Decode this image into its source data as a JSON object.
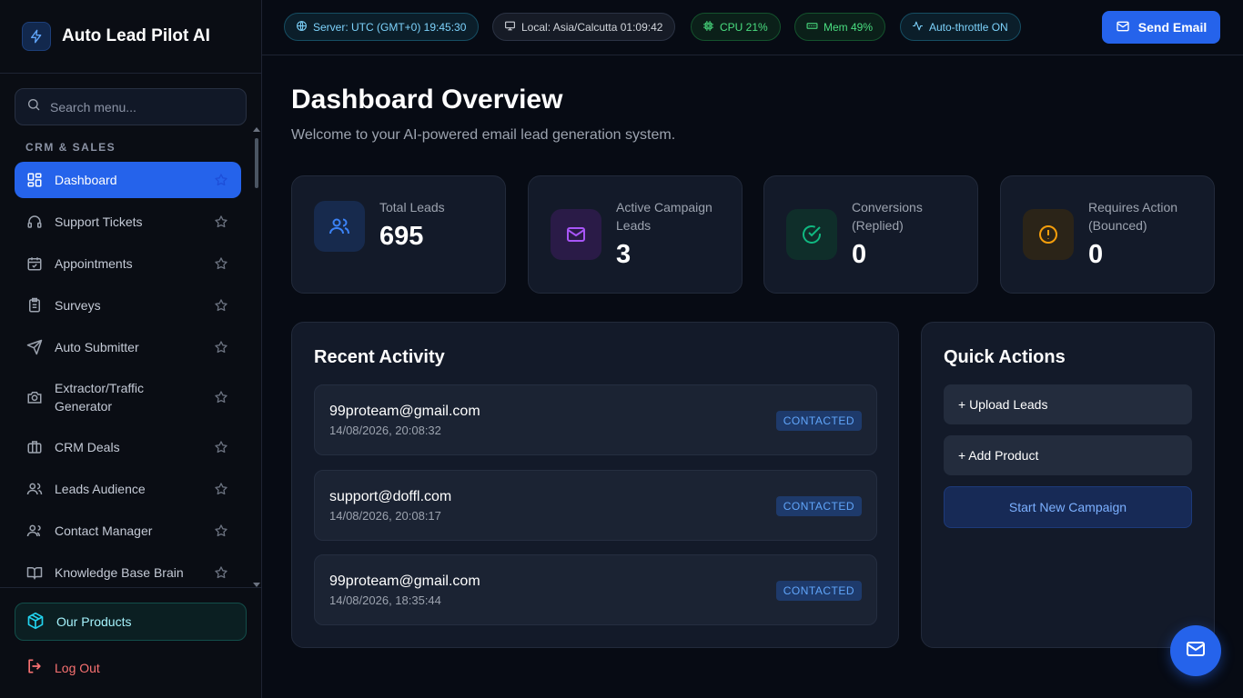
{
  "brand": {
    "title": "Auto Lead Pilot AI",
    "icon": "bolt-icon"
  },
  "search": {
    "placeholder": "Search menu..."
  },
  "sidebar": {
    "section_label": "CRM & SALES",
    "items": [
      {
        "label": "Dashboard",
        "icon": "dashboard-grid-icon",
        "active": true
      },
      {
        "label": "Support Tickets",
        "icon": "headset-icon"
      },
      {
        "label": "Appointments",
        "icon": "calendar-check-icon"
      },
      {
        "label": "Surveys",
        "icon": "clipboard-list-icon"
      },
      {
        "label": "Auto Submitter",
        "icon": "send-icon"
      },
      {
        "label": "Extractor/Traffic Generator",
        "icon": "camera-icon"
      },
      {
        "label": "CRM Deals",
        "icon": "briefcase-icon"
      },
      {
        "label": "Leads Audience",
        "icon": "users-icon"
      },
      {
        "label": "Contact Manager",
        "icon": "user-group-icon"
      },
      {
        "label": "Knowledge Base Brain",
        "icon": "book-open-icon"
      }
    ],
    "footer": {
      "products_label": "Our Products",
      "logout_label": "Log Out"
    }
  },
  "topbar": {
    "server": "Server: UTC (GMT+0) 19:45:30",
    "local": "Local: Asia/Calcutta 01:09:42",
    "cpu": "CPU 21%",
    "mem": "Mem 49%",
    "throttle": "Auto-throttle ON",
    "send_email_label": "Send Email"
  },
  "page": {
    "title": "Dashboard Overview",
    "subtitle": "Welcome to your AI-powered email lead generation system."
  },
  "stats": [
    {
      "label": "Total Leads",
      "value": "695",
      "icon": "users-icon",
      "color": "#3b82f6"
    },
    {
      "label": "Active Campaign Leads",
      "value": "3",
      "icon": "mail-icon",
      "color": "#a855f7"
    },
    {
      "label": "Conversions (Replied)",
      "value": "0",
      "icon": "check-circle-icon",
      "color": "#10b981"
    },
    {
      "label": "Requires Action (Bounced)",
      "value": "0",
      "icon": "alert-circle-icon",
      "color": "#f59e0b"
    }
  ],
  "recent_activity": {
    "title": "Recent Activity",
    "items": [
      {
        "email": "99proteam@gmail.com",
        "time": "14/08/2026, 20:08:32",
        "status": "CONTACTED"
      },
      {
        "email": "support@doffl.com",
        "time": "14/08/2026, 20:08:17",
        "status": "CONTACTED"
      },
      {
        "email": "99proteam@gmail.com",
        "time": "14/08/2026, 18:35:44",
        "status": "CONTACTED"
      }
    ]
  },
  "quick_actions": {
    "title": "Quick Actions",
    "upload_leads": "+ Upload Leads",
    "add_product": "+ Add Product",
    "start_campaign": "Start New Campaign"
  },
  "colors": {
    "accent": "#2563eb",
    "background": "#070b14",
    "card": "#131a29",
    "danger": "#f87171",
    "success": "#4ade80",
    "info": "#7dd3fc"
  }
}
